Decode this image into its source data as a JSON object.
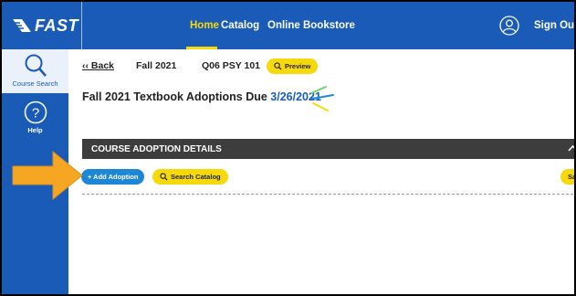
{
  "header": {
    "logo_text": "FAST",
    "nav": {
      "home": "Home",
      "catalog": "Catalog",
      "bookstore": "Online Bookstore"
    },
    "sign_out": "Sign Out"
  },
  "sidebar": {
    "course_search": "Course Search",
    "help": "Help"
  },
  "breadcrumb": {
    "back": "‹‹ Back",
    "term": "Fall 2021",
    "course": "Q06 PSY 101",
    "preview": "Preview"
  },
  "title": {
    "prefix": "Fall 2021 Textbook Adoptions Due ",
    "due_date": "3/26/2021"
  },
  "section": {
    "heading": "COURSE ADOPTION DETAILS"
  },
  "actions": {
    "add_adoption": "+ Add Adoption",
    "search_catalog": "Search Catalog",
    "right_partial": "Sa"
  },
  "colors": {
    "brand_blue": "#1a5bb8",
    "accent_yellow": "#f5d90a",
    "add_blue": "#1d87d6",
    "arrow_orange": "#f5a623",
    "section_dark": "#3d3d3d"
  }
}
